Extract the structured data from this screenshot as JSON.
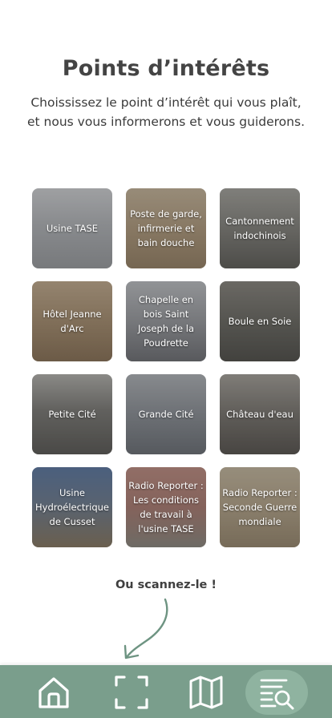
{
  "header": {
    "title": "Points d’intérêts",
    "subtitle": "Choississez le point d’intérêt qui vous plaît, et nous vous informerons et vous guiderons."
  },
  "points": [
    {
      "label": "Usine TASE",
      "tone": "#b9bcc0"
    },
    {
      "label": "Poste de garde, infirmerie et bain douche",
      "tone": "#b8a385"
    },
    {
      "label": "Cantonnement indochinois",
      "tone": "#8d8c86"
    },
    {
      "label": "Hôtel Jeanne d'Arc",
      "tone": "#a88f70"
    },
    {
      "label": "Chapelle en bois Saint Joseph de la Poudrette",
      "tone": "#9c9ea3"
    },
    {
      "label": "Boule en Soie",
      "tone": "#6f6e68"
    },
    {
      "label": "Petite Cité",
      "tone": "#7d7c78"
    },
    {
      "label": "Grande Cité",
      "tone": "#8e939a"
    },
    {
      "label": "Château d'eau",
      "tone": "#7a7670"
    },
    {
      "label": "Usine Hydroélectrique de Cusset",
      "tone": "#6f7f94"
    },
    {
      "label": "Radio Reporter : Les conditions de travail à l'usine TASE",
      "tone": "#b07e74"
    },
    {
      "label": "Radio Reporter : Seconde Guerre mondiale",
      "tone": "#b9a88c"
    }
  ],
  "scan": {
    "text": "Ou scannez-le !"
  },
  "colors": {
    "nav_bg": "#7a9e8c",
    "nav_active": "#8fb3a0",
    "accent": "#6e9482"
  },
  "nav": [
    {
      "icon": "home-icon"
    },
    {
      "icon": "scan-icon"
    },
    {
      "icon": "map-icon"
    },
    {
      "icon": "list-search-icon",
      "active": true
    }
  ]
}
